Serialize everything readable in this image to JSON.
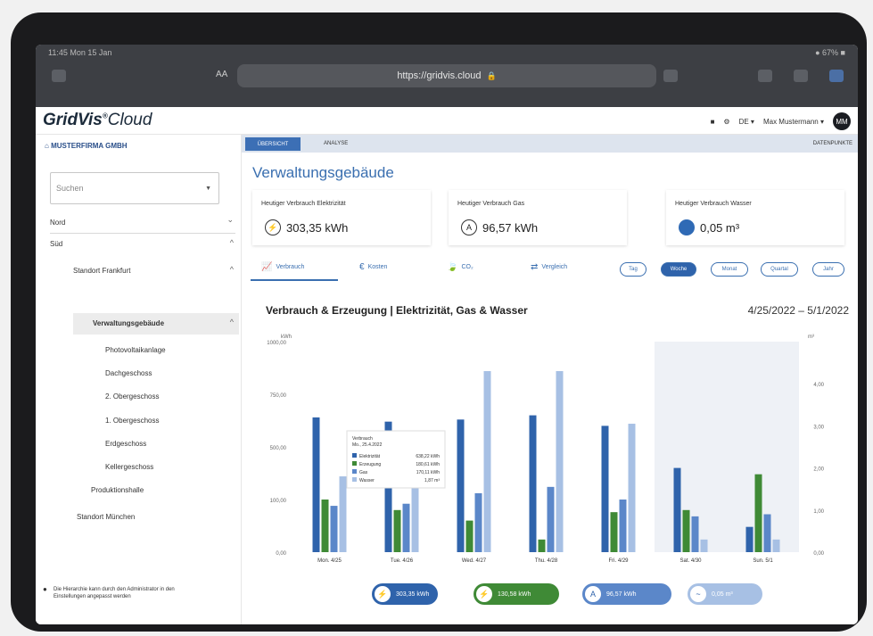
{
  "browser": {
    "time": "11:45  Mon 15 Jan",
    "battery": "● 67% ■",
    "url": "https://gridvis.cloud",
    "aa": "AA"
  },
  "app": {
    "logo_main": "GridVis",
    "logo_reg": "®",
    "logo_cloud": "Cloud",
    "lang": "DE",
    "user": "Max Mustermann",
    "avatar": "MM"
  },
  "sidebar": {
    "company": "MUSTERFIRMA GMBH",
    "search_placeholder": "Suchen",
    "items": [
      {
        "label": "Nord"
      },
      {
        "label": "Süd"
      },
      {
        "label": "Standort Frankfurt"
      },
      {
        "label": "Verwaltungsgebäude"
      },
      {
        "label": "Photovoltaikanlage"
      },
      {
        "label": "Dachgeschoss"
      },
      {
        "label": "2. Obergeschoss"
      },
      {
        "label": "1. Obergeschoss"
      },
      {
        "label": "Erdgeschoss"
      },
      {
        "label": "Kellergeschoss"
      },
      {
        "label": "Produktionshalle"
      },
      {
        "label": "Standort München"
      }
    ],
    "note": "Die Hierarchie kann durch den Administrator in den Einstellungen angepasst werden"
  },
  "main": {
    "tabs": {
      "overview": "ÜBERSICHT",
      "analyse": "ANALYSE",
      "datapoints": "DATENPUNKTE"
    },
    "title": "Verwaltungsgebäude",
    "cards": [
      {
        "title": "Heutiger Verbrauch Elektrizität",
        "value": "303,35 kWh",
        "icon": "⚡"
      },
      {
        "title": "Heutiger Verbrauch Gas",
        "value": "96,57 kWh",
        "icon": "A"
      },
      {
        "title": "Heutiger Verbrauch Wasser",
        "value": "0,05 m³",
        "icon": "water-icon"
      }
    ],
    "view_tabs": [
      {
        "label": "Verbrauch",
        "icon": "📈"
      },
      {
        "label": "Kosten",
        "icon": "€"
      },
      {
        "label": "CO₂",
        "icon": "🍃"
      },
      {
        "label": "Vergleich",
        "icon": "⇄"
      }
    ],
    "periods": [
      "Tag",
      "Woche",
      "Monat",
      "Quartal",
      "Jahr"
    ],
    "active_period": "Woche",
    "chart_title": "Verbrauch & Erzeugung | Elektrizität, Gas & Wasser",
    "date_range": "4/25/2022 – 5/1/2022",
    "tooltip": {
      "title": "Verbrauch",
      "date": "Mo., 25.4.2022",
      "rows": [
        {
          "label": "Elektrizität",
          "value": "638,22 kWh"
        },
        {
          "label": "Erzeugung",
          "value": "180,61 kWh"
        },
        {
          "label": "Gas",
          "value": "170,11 kWh"
        },
        {
          "label": "Wasser",
          "value": "1,87 m³"
        }
      ]
    },
    "legend": [
      {
        "label": "303,35 kWh",
        "icon": "⚡",
        "color": "#2f63ab"
      },
      {
        "label": "130,58 kWh",
        "icon": "⚡",
        "color": "#3f8a36"
      },
      {
        "label": "96,57 kWh",
        "icon": "A",
        "color": "#5b87c9"
      },
      {
        "label": "0,05 m³",
        "icon": "~",
        "color": "#a7c0e4"
      }
    ]
  },
  "chart_data": {
    "type": "bar",
    "categories": [
      "Mon. 4/25",
      "Tue. 4/26",
      "Wed. 4/27",
      "Thu. 4/28",
      "Fri. 4/29",
      "Sat. 4/30",
      "Sun. 5/1"
    ],
    "series": [
      {
        "name": "Elektrizität",
        "axis": "left",
        "color": "#2f63ab",
        "values": [
          640,
          620,
          630,
          650,
          600,
          400,
          120
        ]
      },
      {
        "name": "Erzeugung",
        "axis": "left",
        "color": "#3f8a36",
        "values": [
          250,
          200,
          150,
          60,
          190,
          200,
          370
        ]
      },
      {
        "name": "Gas",
        "axis": "left",
        "color": "#5b87c9",
        "values": [
          220,
          230,
          280,
          310,
          250,
          170,
          180
        ]
      },
      {
        "name": "Wasser",
        "axis": "right",
        "color": "#a7c0e4",
        "values": [
          1.8,
          1.7,
          4.3,
          4.3,
          3.05,
          0.3,
          0.3
        ]
      }
    ],
    "ylabel": "kWh",
    "y2label": "m³",
    "yticks": [
      "0,00",
      "100,00",
      "500,00",
      "750,00",
      "1000,00"
    ],
    "y2ticks": [
      "0,00",
      "1,00",
      "2,00",
      "3,00",
      "4,00"
    ],
    "ylim": [
      0,
      1000
    ],
    "y2lim": [
      0,
      5
    ],
    "highlight_category": "Sat. 4/30"
  }
}
